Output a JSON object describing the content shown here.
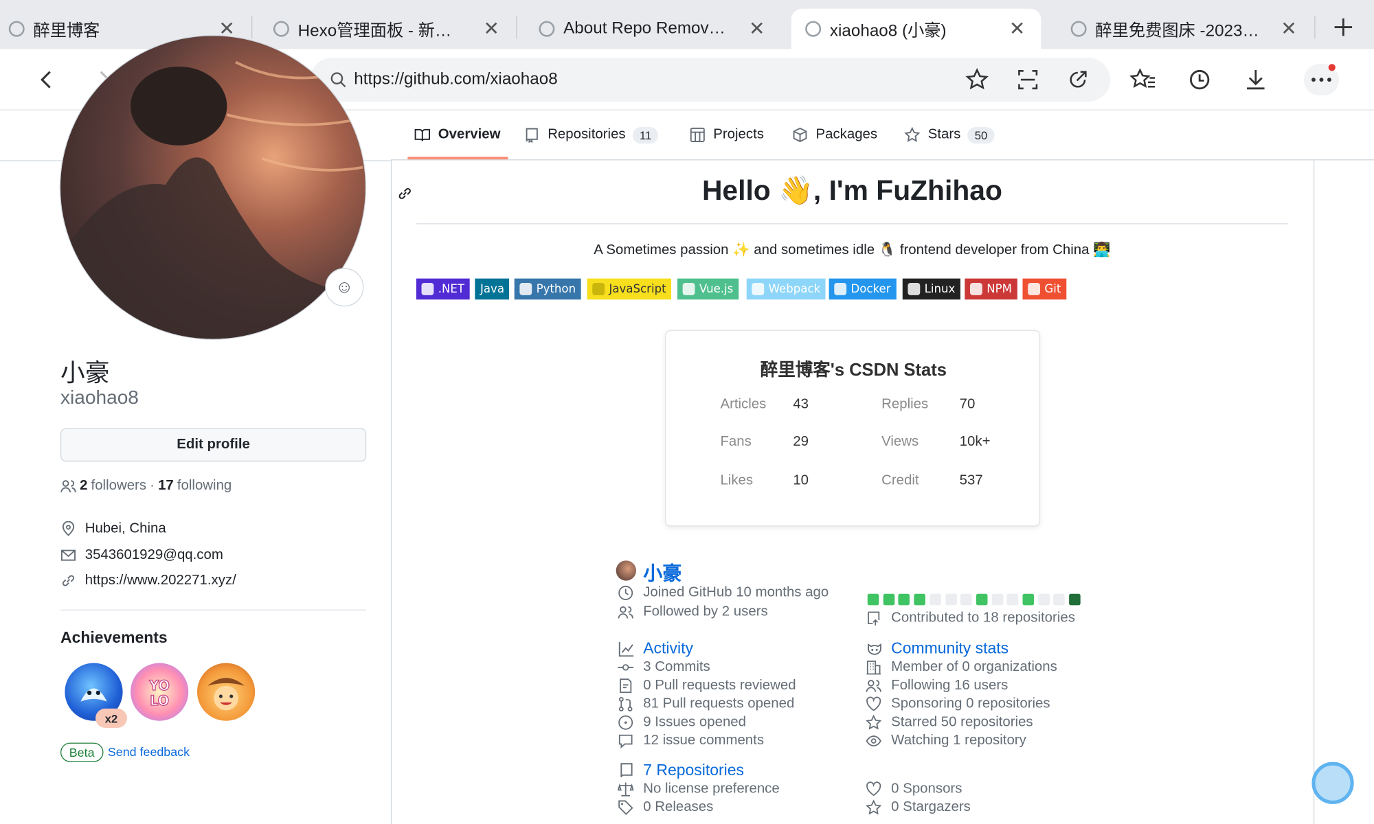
{
  "browser": {
    "tabs": [
      {
        "title": "醉里博客"
      },
      {
        "title": "Hexo管理面板 - 新…"
      },
      {
        "title": "About Repo Remov…"
      },
      {
        "title": "xiaohao8 (小豪)"
      },
      {
        "title": "醉里免费图床 -2023…"
      }
    ],
    "active_tab": 3,
    "url": "https://github.com/xiaohao8",
    "new_tab_icon": "plus-icon"
  },
  "nav": {
    "overview": "Overview",
    "repositories": "Repositories",
    "repositories_count": "11",
    "projects": "Projects",
    "packages": "Packages",
    "stars": "Stars",
    "stars_count": "50"
  },
  "profile": {
    "fullname": "小豪",
    "login": "xiaohao8",
    "edit_button": "Edit profile",
    "followers_count": "2",
    "followers_label": "followers",
    "separator": "·",
    "following_count": "17",
    "following_label": "following",
    "location": "Hubei, China",
    "email": "3543601929@qq.com",
    "website": "https://www.202271.xyz/",
    "achievements_title": "Achievements",
    "achievement_multiplier": "x2",
    "beta_label": "Beta",
    "feedback_link": "Send feedback"
  },
  "readme": {
    "greeting": "Hello 👋, I'm FuZhihao",
    "tagline": "A Sometimes passion ✨ and sometimes idle 🐧 frontend developer from China 👨‍💻",
    "badges": [
      {
        "label": ".NET",
        "color": "#512bd4"
      },
      {
        "label": "Java",
        "color": "#007396"
      },
      {
        "label": "Python",
        "color": "#3776ab"
      },
      {
        "label": "JavaScript",
        "color": "#f7df1e"
      },
      {
        "label": "Vue.js",
        "color": "#4fc08d"
      },
      {
        "label": "Webpack",
        "color": "#8dd6f9"
      },
      {
        "label": "Docker",
        "color": "#2496ed"
      },
      {
        "label": "Linux",
        "color": "#222222"
      },
      {
        "label": "NPM",
        "color": "#cb3837"
      },
      {
        "label": "Git",
        "color": "#f05032"
      }
    ],
    "csdn_card": {
      "title": "醉里博客's CSDN Stats",
      "stats": [
        {
          "label": "Articles",
          "value": "43"
        },
        {
          "label": "Replies",
          "value": "70"
        },
        {
          "label": "Fans",
          "value": "29"
        },
        {
          "label": "Views",
          "value": "10k+"
        },
        {
          "label": "Likes",
          "value": "10"
        },
        {
          "label": "Credit",
          "value": "537"
        }
      ]
    },
    "summary": {
      "name": "小豪",
      "joined": "Joined GitHub 10 months ago",
      "followed_by": "Followed by 2 users",
      "contributed": "Contributed to 18 repositories",
      "activity_title": "Activity",
      "activity": [
        "3 Commits",
        "0 Pull requests reviewed",
        "81 Pull requests opened",
        "9 Issues opened",
        "12 issue comments"
      ],
      "community_title": "Community stats",
      "community": [
        "Member of 0 organizations",
        "Following 16 users",
        "Sponsoring 0 repositories",
        "Starred 50 repositories",
        "Watching 1 repository"
      ],
      "repos_title": "7 Repositories",
      "repos": [
        "No license preference",
        "0 Releases"
      ],
      "repos_right": [
        "0 Sponsors",
        "0 Stargazers"
      ],
      "contribution_levels": [
        2,
        2,
        2,
        2,
        0,
        0,
        0,
        2,
        0,
        0,
        2,
        0,
        0,
        3
      ]
    }
  },
  "colors": {
    "accent_link": "#0969da",
    "tab_underline": "#fd8c73",
    "contrib": [
      "#ebedf0",
      "#9be9a8",
      "#40c463",
      "#216e39"
    ]
  }
}
